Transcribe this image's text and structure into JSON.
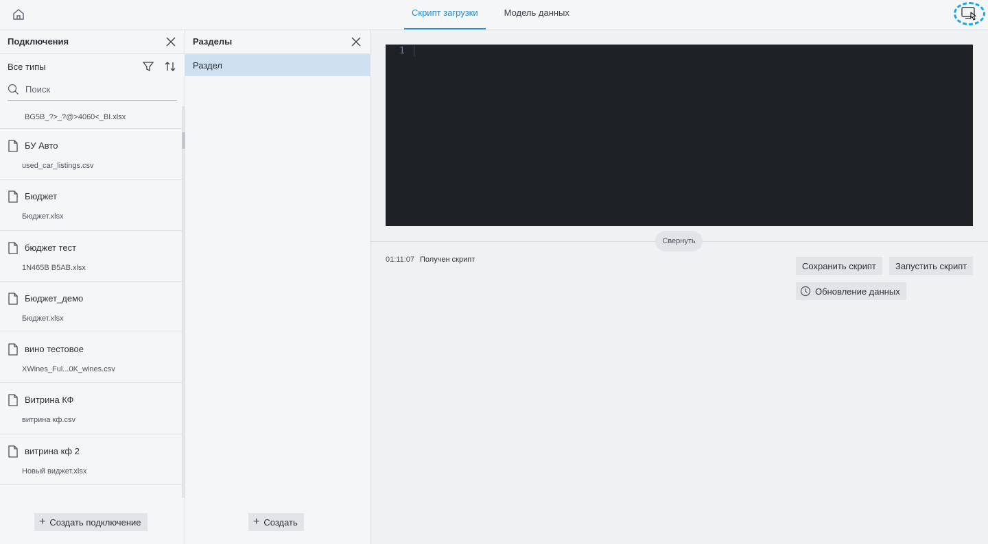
{
  "topbar": {
    "home_icon": "home-icon",
    "tabs": [
      {
        "label": "Скрипт загрузки",
        "active": true
      },
      {
        "label": "Модель данных",
        "active": false
      }
    ],
    "screen_icon": "monitor-cursor-icon"
  },
  "connections": {
    "title": "Подключения",
    "filter_label": "Все типы",
    "search_placeholder": "Поиск",
    "first_partial_file": "BG5B_?>_?@>4060<_BI.xlsx",
    "items": [
      {
        "name": "БУ Авто",
        "file": "used_car_listings.csv"
      },
      {
        "name": "Бюджет",
        "file": "Бюджет.xlsx"
      },
      {
        "name": "бюджет тест",
        "file": "1N465B B5AB.xlsx"
      },
      {
        "name": "Бюджет_демо",
        "file": "Бюджет.xlsx"
      },
      {
        "name": "вино тестовое",
        "file": "XWines_Ful...0K_wines.csv"
      },
      {
        "name": "Витрина КФ",
        "file": "витрина кф.csv"
      },
      {
        "name": "витрина кф 2",
        "file": "Новый виджет.xlsx"
      }
    ],
    "create_label": "Создать подключение"
  },
  "sections": {
    "title": "Разделы",
    "items": [
      {
        "label": "Раздел",
        "selected": true
      }
    ],
    "create_label": "Создать"
  },
  "editor": {
    "line_number": "1"
  },
  "collapse_label": "Свернуть",
  "log": {
    "time": "01:11:07",
    "message": "Получен скрипт"
  },
  "actions": {
    "save_label": "Сохранить скрипт",
    "run_label": "Запустить скрипт",
    "refresh_label": "Обновление данных"
  },
  "colors": {
    "accent": "#1f8dd6",
    "selected_bg": "#cfe1f1",
    "editor_bg": "#1e2126",
    "highlight_ring": "#19a7e8"
  }
}
